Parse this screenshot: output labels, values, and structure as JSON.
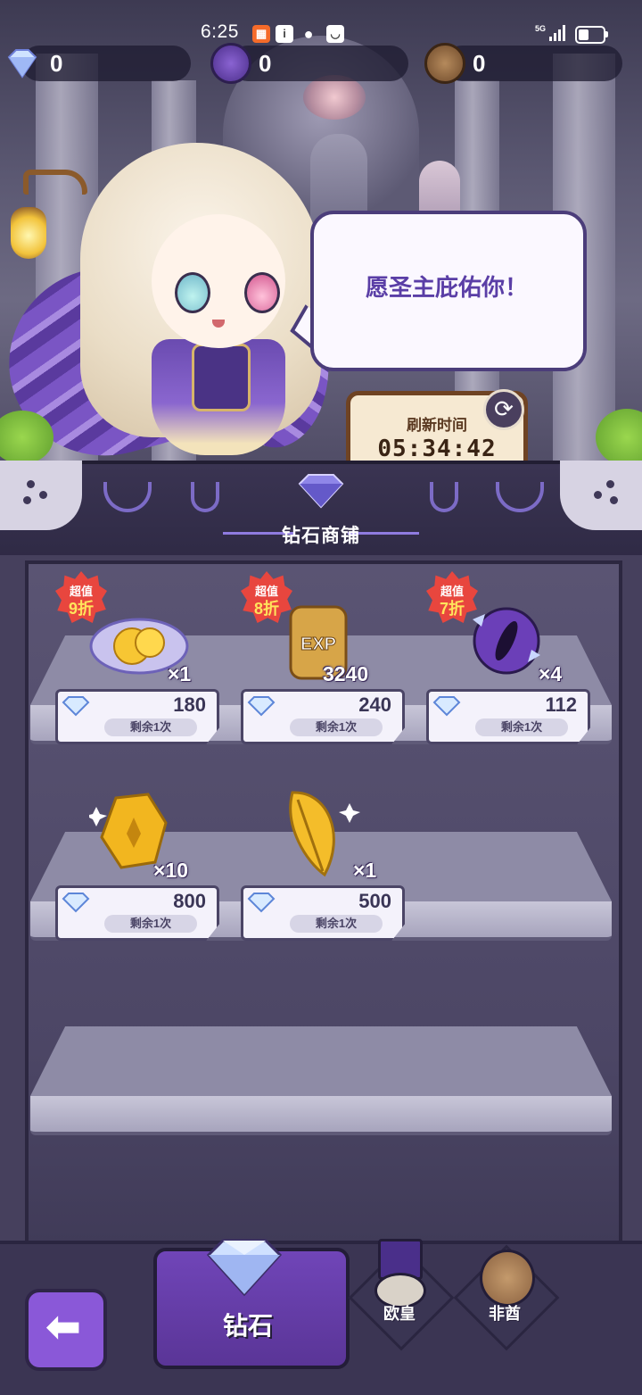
{
  "status_bar": {
    "time": "6:25",
    "network": "5G"
  },
  "currencies": [
    {
      "name": "diamond",
      "icon": "diamond-icon",
      "value": "0"
    },
    {
      "name": "ouhuang",
      "icon": "top-hat-icon",
      "value": "0"
    },
    {
      "name": "feiqiu",
      "icon": "bear-icon",
      "value": "0"
    }
  ],
  "speech_bubble": "愿圣主庇佑你！",
  "refresh": {
    "label": "刷新时间",
    "countdown": "05:34:42"
  },
  "shop": {
    "title": "钻石商铺"
  },
  "items": [
    {
      "icon": "golden-fruit-crystal-icon",
      "quantity": "×1",
      "badge_top": "超值",
      "badge_bottom": "9折",
      "price": "180",
      "remaining": "剩余1次"
    },
    {
      "icon": "exp-scroll-icon",
      "quantity": "3240",
      "badge_top": "超值",
      "badge_bottom": "8折",
      "price": "240",
      "remaining": "剩余1次"
    },
    {
      "icon": "purple-eye-orb-icon",
      "quantity": "×4",
      "badge_top": "超值",
      "badge_bottom": "7折",
      "price": "112",
      "remaining": "剩余1次"
    },
    {
      "icon": "gold-medal-icon",
      "quantity": "×10",
      "price": "800",
      "remaining": "剩余1次"
    },
    {
      "icon": "gold-feather-icon",
      "quantity": "×1",
      "price": "500",
      "remaining": "剩余1次"
    }
  ],
  "bottom_nav": {
    "back_icon": "back-arrow-icon",
    "tabs": [
      {
        "label": "钻石",
        "icon": "diamond-icon",
        "active": true
      },
      {
        "label": "欧皇",
        "icon": "top-hat-icon",
        "active": false
      },
      {
        "label": "非酋",
        "icon": "bear-icon",
        "active": false
      }
    ]
  },
  "colors": {
    "accent": "#8a58d8",
    "price_text": "#3a3556",
    "badge": "#e8463e",
    "bubble_text": "#5a3ea6"
  }
}
